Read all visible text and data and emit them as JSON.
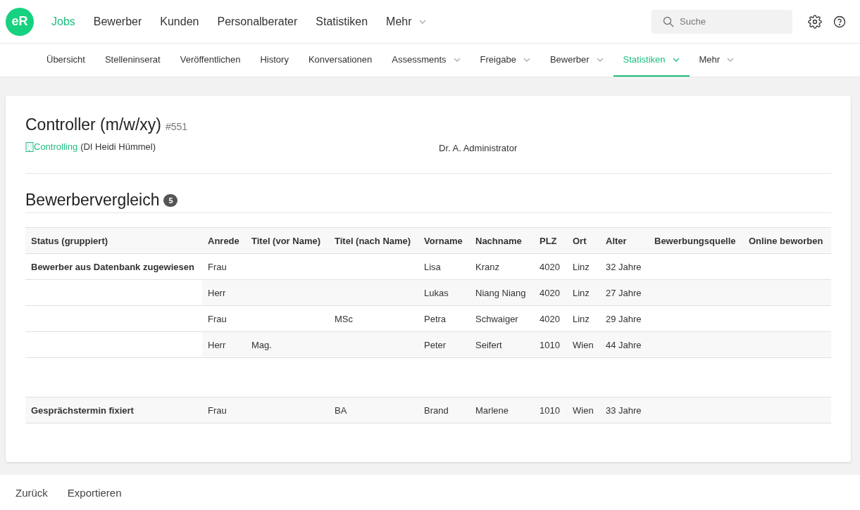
{
  "logo": "eR",
  "main_nav": [
    {
      "label": "Jobs",
      "selected": true,
      "dropdown": false
    },
    {
      "label": "Bewerber",
      "selected": false,
      "dropdown": false
    },
    {
      "label": "Kunden",
      "selected": false,
      "dropdown": false
    },
    {
      "label": "Personalberater",
      "selected": false,
      "dropdown": false
    },
    {
      "label": "Statistiken",
      "selected": false,
      "dropdown": false
    },
    {
      "label": "Mehr",
      "selected": false,
      "dropdown": true
    }
  ],
  "search": {
    "placeholder": "Suche"
  },
  "sub_nav": [
    {
      "label": "Übersicht",
      "selected": false,
      "dropdown": false
    },
    {
      "label": "Stelleninserat",
      "selected": false,
      "dropdown": false
    },
    {
      "label": "Veröffentlichen",
      "selected": false,
      "dropdown": false
    },
    {
      "label": "History",
      "selected": false,
      "dropdown": false
    },
    {
      "label": "Konversationen",
      "selected": false,
      "dropdown": false
    },
    {
      "label": "Assessments",
      "selected": false,
      "dropdown": true
    },
    {
      "label": "Freigabe",
      "selected": false,
      "dropdown": true
    },
    {
      "label": "Bewerber",
      "selected": false,
      "dropdown": true
    },
    {
      "label": "Statistiken",
      "selected": true,
      "dropdown": true
    },
    {
      "label": "Mehr",
      "selected": false,
      "dropdown": true
    }
  ],
  "job": {
    "title": "Controller (m/w/xy)",
    "number": "#551",
    "department": "Controlling",
    "contact": "(DI Heidi Hümmel)",
    "owner": "Dr. A. Administrator"
  },
  "section": {
    "title": "Bewerbervergleich",
    "count": "5"
  },
  "table": {
    "columns": [
      "Status (gruppiert)",
      "Anrede",
      "Titel (vor Name)",
      "Titel (nach Name)",
      "Vorname",
      "Nachname",
      "PLZ",
      "Ort",
      "Alter",
      "Bewerbungsquelle",
      "Online beworben"
    ],
    "groups": [
      {
        "status": "Bewerber aus Datenbank zugewiesen",
        "rows": [
          [
            "Frau",
            null,
            null,
            "Lisa",
            "Kranz",
            "4020",
            "Linz",
            "32 Jahre"
          ],
          [
            "Herr",
            null,
            null,
            "Lukas",
            "Niang Niang",
            "4020",
            "Linz",
            "27 Jahre"
          ],
          [
            "Frau",
            null,
            "MSc",
            "Petra",
            "Schwaiger",
            "4020",
            "Linz",
            "29 Jahre"
          ],
          [
            "Herr",
            "Mag.",
            null,
            "Peter",
            "Seifert",
            "1010",
            "Wien",
            "44 Jahre"
          ]
        ]
      },
      {
        "status": "Gesprächstermin fixiert",
        "rows": [
          [
            "Frau",
            null,
            "BA",
            "Brand",
            "Marlene",
            "1010",
            "Wien",
            "33 Jahre"
          ]
        ]
      }
    ]
  },
  "footer_buttons": [
    "Zurück",
    "Exportieren"
  ]
}
